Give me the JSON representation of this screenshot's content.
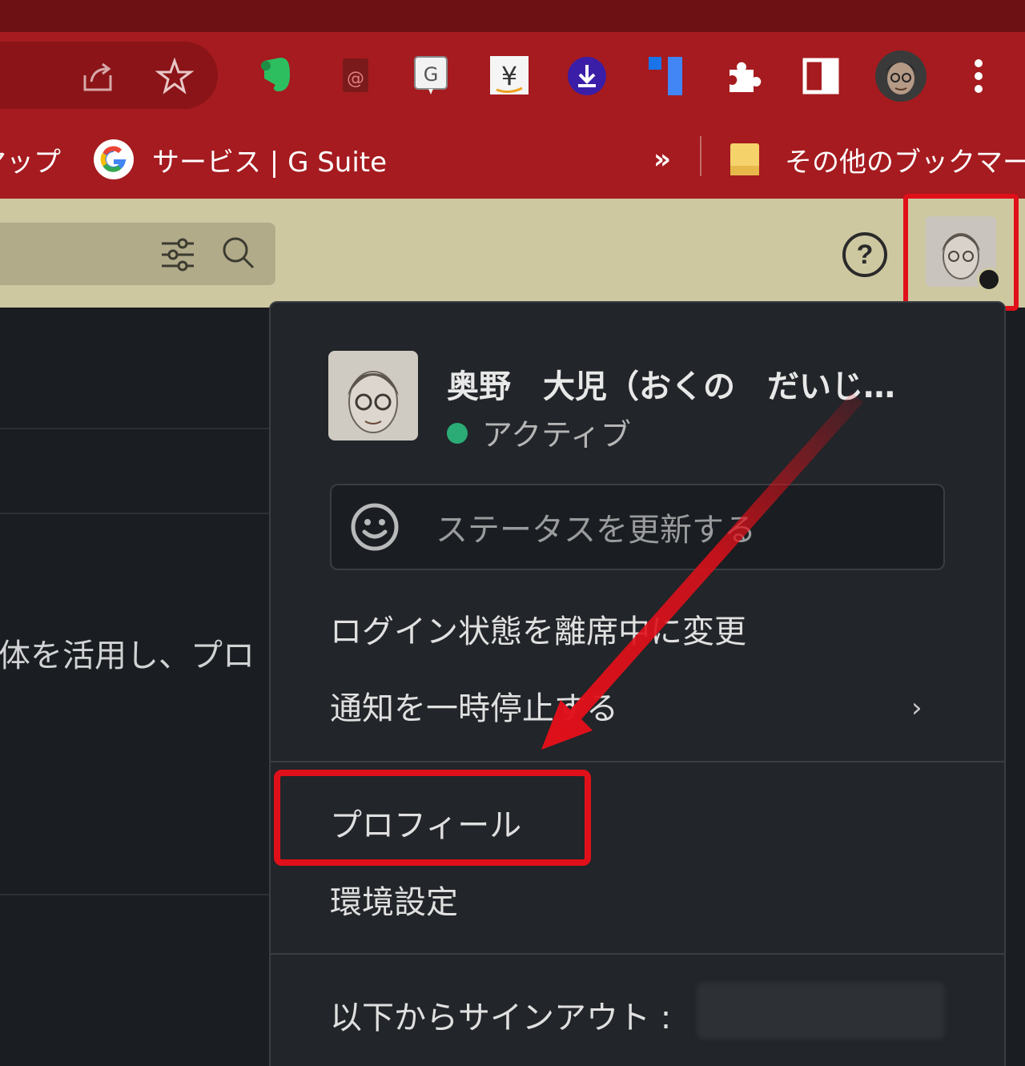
{
  "browser": {
    "extensions": [
      "evernote-icon",
      "mail-extension-icon",
      "g-extension-icon",
      "yen-extension-icon",
      "download-icon",
      "blue-extension-icon",
      "puzzle-icon",
      "side-panel-icon"
    ],
    "bookmarks": {
      "partial_item": "マップ",
      "gsuite": "サービス | G Suite",
      "overflow": "»",
      "other": "その他のブックマーク"
    },
    "colors": {
      "toolbar": "#a51b1f",
      "titlebar": "#6e1114"
    }
  },
  "app_header": {
    "help": "?",
    "colors": {
      "header": "#cec8a1"
    }
  },
  "background_page": {
    "text": "体を活用し、プロ"
  },
  "menu": {
    "user_name": "奥野　大児（おくの　だいじ…",
    "presence": "アクティブ",
    "status_placeholder": "ステータスを更新する",
    "items": {
      "away": "ログイン状態を離席中に変更",
      "pause_notifications": "通知を一時停止する",
      "profile": "プロフィール",
      "preferences": "環境設定",
      "sign_out": "以下からサインアウト :"
    },
    "colors": {
      "presence_active": "#2bac76",
      "highlight": "#e0101a",
      "background": "#222529"
    }
  }
}
